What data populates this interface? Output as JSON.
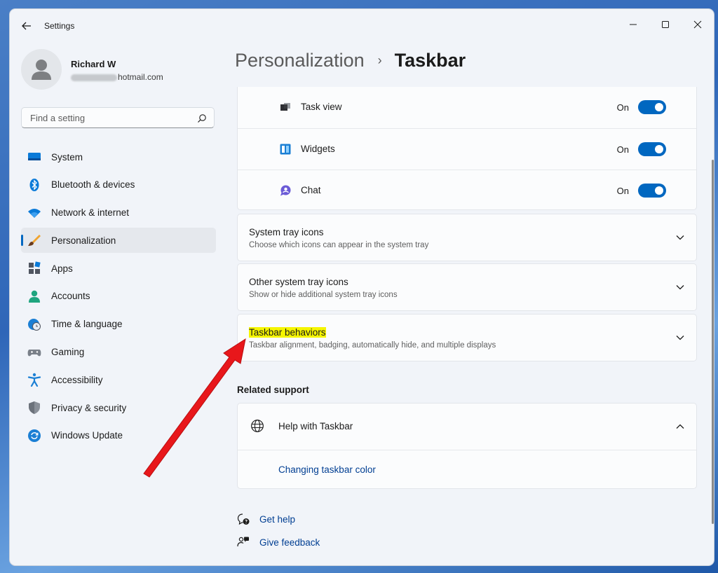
{
  "window": {
    "title": "Settings"
  },
  "profile": {
    "name": "Richard W",
    "email_visible": "hotmail.com"
  },
  "search": {
    "placeholder": "Find a setting"
  },
  "sidebar": {
    "items": [
      {
        "label": "System",
        "icon": "monitor-icon"
      },
      {
        "label": "Bluetooth & devices",
        "icon": "bluetooth-icon"
      },
      {
        "label": "Network & internet",
        "icon": "wifi-icon"
      },
      {
        "label": "Personalization",
        "icon": "brush-icon",
        "active": true
      },
      {
        "label": "Apps",
        "icon": "apps-icon"
      },
      {
        "label": "Accounts",
        "icon": "person-icon"
      },
      {
        "label": "Time & language",
        "icon": "globe-clock-icon"
      },
      {
        "label": "Gaming",
        "icon": "gamepad-icon"
      },
      {
        "label": "Accessibility",
        "icon": "accessibility-icon"
      },
      {
        "label": "Privacy & security",
        "icon": "shield-icon"
      },
      {
        "label": "Windows Update",
        "icon": "update-icon"
      }
    ]
  },
  "breadcrumb": {
    "parent": "Personalization",
    "separator": "›",
    "current": "Taskbar"
  },
  "taskbar_items": [
    {
      "label": "Task view",
      "state": "On"
    },
    {
      "label": "Widgets",
      "state": "On"
    },
    {
      "label": "Chat",
      "state": "On"
    }
  ],
  "sections": [
    {
      "title": "System tray icons",
      "subtitle": "Choose which icons can appear in the system tray"
    },
    {
      "title": "Other system tray icons",
      "subtitle": "Show or hide additional system tray icons"
    },
    {
      "title": "Taskbar behaviors",
      "subtitle": "Taskbar alignment, badging, automatically hide, and multiple displays"
    }
  ],
  "related": {
    "title": "Related support",
    "help_title": "Help with Taskbar",
    "link": "Changing taskbar color"
  },
  "footer": {
    "get_help": "Get help",
    "give_feedback": "Give feedback"
  },
  "colors": {
    "accent": "#0067c0",
    "highlight": "#f5f500",
    "annotation_arrow": "#e8171b"
  }
}
